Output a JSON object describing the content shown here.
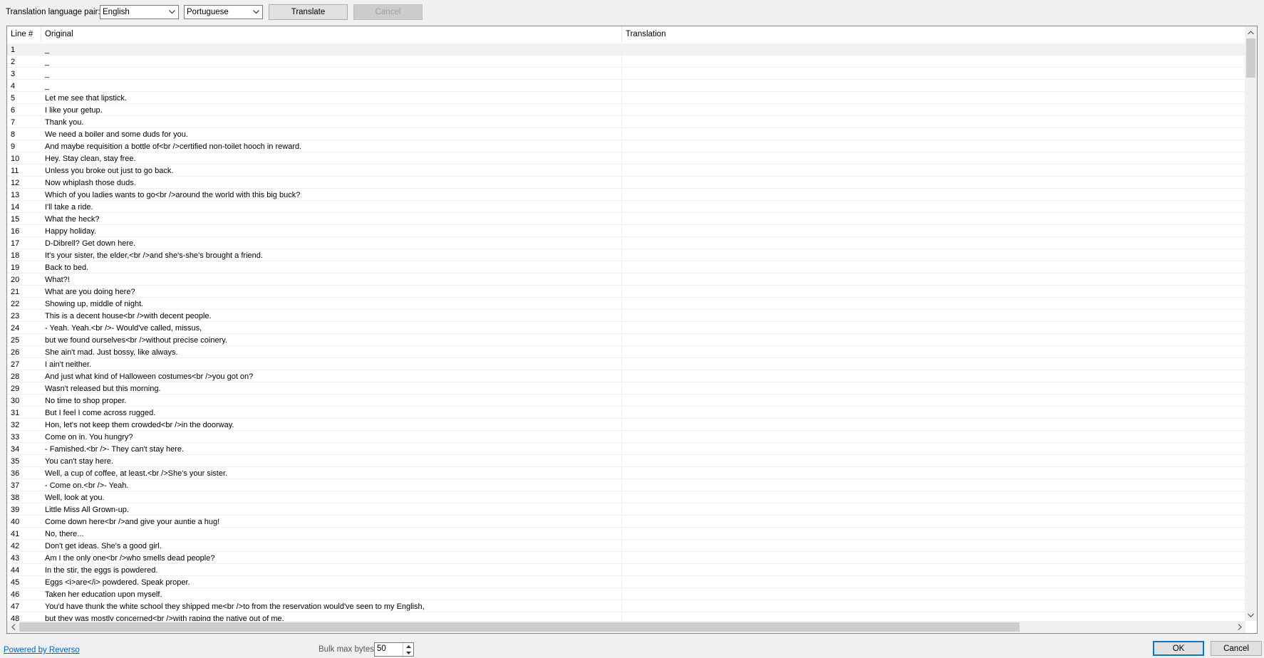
{
  "toolbar": {
    "pair_label": "Translation language pair:",
    "source_language": "English",
    "target_language": "Portuguese",
    "translate_label": "Translate",
    "cancel_label": "Cancel"
  },
  "grid": {
    "columns": [
      "Line #",
      "Original",
      "Translation"
    ],
    "rows": [
      {
        "n": "1",
        "o": "_",
        "t": ""
      },
      {
        "n": "2",
        "o": "_",
        "t": ""
      },
      {
        "n": "3",
        "o": "_",
        "t": ""
      },
      {
        "n": "4",
        "o": "_",
        "t": ""
      },
      {
        "n": "5",
        "o": "Let me see that lipstick.",
        "t": ""
      },
      {
        "n": "6",
        "o": "I like your getup.",
        "t": ""
      },
      {
        "n": "7",
        "o": "Thank you.",
        "t": ""
      },
      {
        "n": "8",
        "o": "We need a boiler and some duds for you.",
        "t": ""
      },
      {
        "n": "9",
        "o": "And maybe requisition a bottle of<br />certified non-toilet hooch in reward.",
        "t": ""
      },
      {
        "n": "10",
        "o": "Hey. Stay clean, stay free.",
        "t": ""
      },
      {
        "n": "11",
        "o": "Unless you broke out just to go back.",
        "t": ""
      },
      {
        "n": "12",
        "o": "Now whiplash those duds.",
        "t": ""
      },
      {
        "n": "13",
        "o": "Which of you ladies wants to go<br />around the world with this big buck?",
        "t": ""
      },
      {
        "n": "14",
        "o": "I'll take a ride.",
        "t": ""
      },
      {
        "n": "15",
        "o": "What the heck?",
        "t": ""
      },
      {
        "n": "16",
        "o": "Happy holiday.",
        "t": ""
      },
      {
        "n": "17",
        "o": "D-Dibrell? Get down here.",
        "t": ""
      },
      {
        "n": "18",
        "o": "It's your sister, the elder,<br />and she's-she's brought a friend.",
        "t": ""
      },
      {
        "n": "19",
        "o": "Back to bed.",
        "t": ""
      },
      {
        "n": "20",
        "o": "What?!",
        "t": ""
      },
      {
        "n": "21",
        "o": "What are you doing here?",
        "t": ""
      },
      {
        "n": "22",
        "o": "Showing up, middle of night.",
        "t": ""
      },
      {
        "n": "23",
        "o": "This is a decent house<br />with decent people.",
        "t": ""
      },
      {
        "n": "24",
        "o": "- Yeah. Yeah.<br />- Would've called, missus,",
        "t": ""
      },
      {
        "n": "25",
        "o": "but we found ourselves<br />without precise coinery.",
        "t": ""
      },
      {
        "n": "26",
        "o": "She ain't mad. Just bossy, like always.",
        "t": ""
      },
      {
        "n": "27",
        "o": "I ain't neither.",
        "t": ""
      },
      {
        "n": "28",
        "o": "And just what kind of Halloween costumes<br />you got on?",
        "t": ""
      },
      {
        "n": "29",
        "o": "Wasn't released but this morning.",
        "t": ""
      },
      {
        "n": "30",
        "o": "No time to shop proper.",
        "t": ""
      },
      {
        "n": "31",
        "o": "But I feel I come across rugged.",
        "t": ""
      },
      {
        "n": "32",
        "o": "Hon, let's not keep them crowded<br />in the doorway.",
        "t": ""
      },
      {
        "n": "33",
        "o": "Come on in. You hungry?",
        "t": ""
      },
      {
        "n": "34",
        "o": "- Famished.<br />- They can't stay here.",
        "t": ""
      },
      {
        "n": "35",
        "o": "You can't stay here.",
        "t": ""
      },
      {
        "n": "36",
        "o": "Well, a cup of coffee, at least.<br />She's your sister.",
        "t": ""
      },
      {
        "n": "37",
        "o": "- Come on.<br />- Yeah.",
        "t": ""
      },
      {
        "n": "38",
        "o": "Well, look at you.",
        "t": ""
      },
      {
        "n": "39",
        "o": "Little Miss All Grown-up.",
        "t": ""
      },
      {
        "n": "40",
        "o": "Come down here<br />and give your auntie a hug!",
        "t": ""
      },
      {
        "n": "41",
        "o": "No, there...",
        "t": ""
      },
      {
        "n": "42",
        "o": "Don't get ideas. She's a good girl.",
        "t": ""
      },
      {
        "n": "43",
        "o": "Am I the only one<br />who smells dead people?",
        "t": ""
      },
      {
        "n": "44",
        "o": "In the stir, the eggs is powdered.",
        "t": ""
      },
      {
        "n": "45",
        "o": "Eggs <i>are</i> powdered. Speak proper.",
        "t": ""
      },
      {
        "n": "46",
        "o": "Taken her education upon myself.",
        "t": ""
      },
      {
        "n": "47",
        "o": "You'd have thunk the white school they shipped me<br />to from the reservation would've seen to my English,",
        "t": ""
      },
      {
        "n": "48",
        "o": "but they was mostly concerned<br />with raping the native out of me.",
        "t": ""
      }
    ]
  },
  "footer": {
    "powered_by": "Powered by Reverso",
    "bulk_label": "Bulk max bytes",
    "bulk_value": "50",
    "ok_label": "OK",
    "cancel_label": "Cancel"
  },
  "icons": {
    "combo_arrow": "chevron-down-icon",
    "scroll_up": "chevron-up-icon",
    "scroll_down": "chevron-down-icon",
    "scroll_left": "chevron-left-icon",
    "scroll_right": "chevron-right-icon"
  }
}
